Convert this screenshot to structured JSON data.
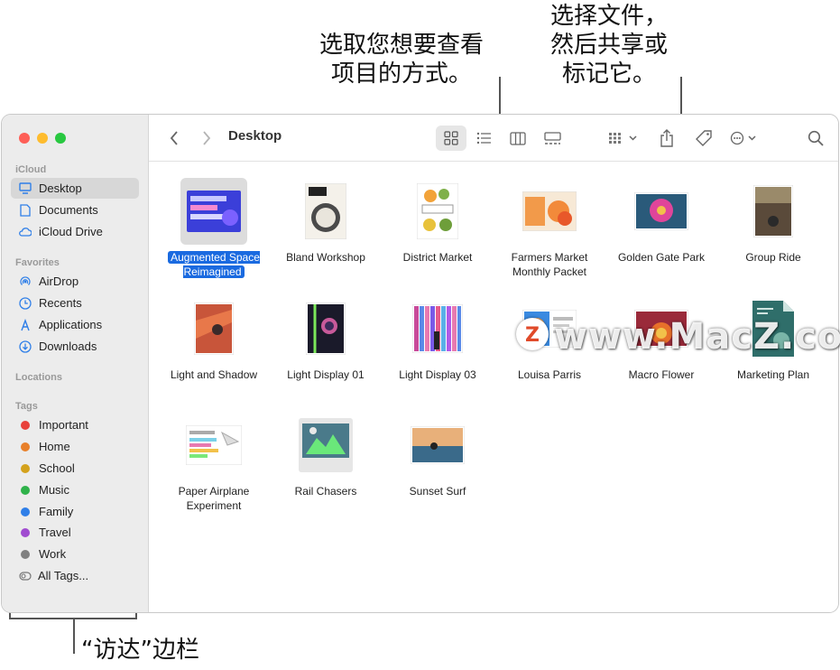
{
  "callouts": {
    "view": "选取您想要查看\n项目的方式。",
    "share": "选择文件，\n然后共享或\n标记它。",
    "sidebar": "“访达”边栏"
  },
  "sidebar": {
    "sections": {
      "icloud": "iCloud",
      "favorites": "Favorites",
      "locations": "Locations",
      "tags": "Tags"
    },
    "icloud_items": [
      {
        "label": "Desktop",
        "icon": "desktop-icon"
      },
      {
        "label": "Documents",
        "icon": "document-icon"
      },
      {
        "label": "iCloud Drive",
        "icon": "cloud-icon"
      }
    ],
    "favorite_items": [
      {
        "label": "AirDrop",
        "icon": "airdrop-icon"
      },
      {
        "label": "Recents",
        "icon": "clock-icon"
      },
      {
        "label": "Applications",
        "icon": "applications-icon"
      },
      {
        "label": "Downloads",
        "icon": "download-icon"
      }
    ],
    "tags": [
      {
        "label": "Important",
        "color": "#e8413b"
      },
      {
        "label": "Home",
        "color": "#e8802a"
      },
      {
        "label": "School",
        "color": "#d4a21c"
      },
      {
        "label": "Music",
        "color": "#2fb24a"
      },
      {
        "label": "Family",
        "color": "#2f7fe8"
      },
      {
        "label": "Travel",
        "color": "#a04bd0"
      },
      {
        "label": "Work",
        "color": "#808080"
      },
      {
        "label": "All Tags...",
        "color": ""
      }
    ]
  },
  "toolbar": {
    "title": "Desktop"
  },
  "files": [
    {
      "name": "Augmented Space Reimagined",
      "selected": true
    },
    {
      "name": "Bland Workshop"
    },
    {
      "name": "District Market"
    },
    {
      "name": "Farmers Market Monthly Packet"
    },
    {
      "name": "Golden Gate Park"
    },
    {
      "name": "Group Ride"
    },
    {
      "name": "Light and Shadow"
    },
    {
      "name": "Light Display 01"
    },
    {
      "name": "Light Display 03"
    },
    {
      "name": "Louisa Parris"
    },
    {
      "name": "Macro Flower"
    },
    {
      "name": "Marketing Plan"
    },
    {
      "name": "Paper Airplane Experiment"
    },
    {
      "name": "Rail Chasers"
    },
    {
      "name": "Sunset Surf"
    }
  ],
  "watermark": "www.MacZ.com",
  "watermark_logo": "Z"
}
